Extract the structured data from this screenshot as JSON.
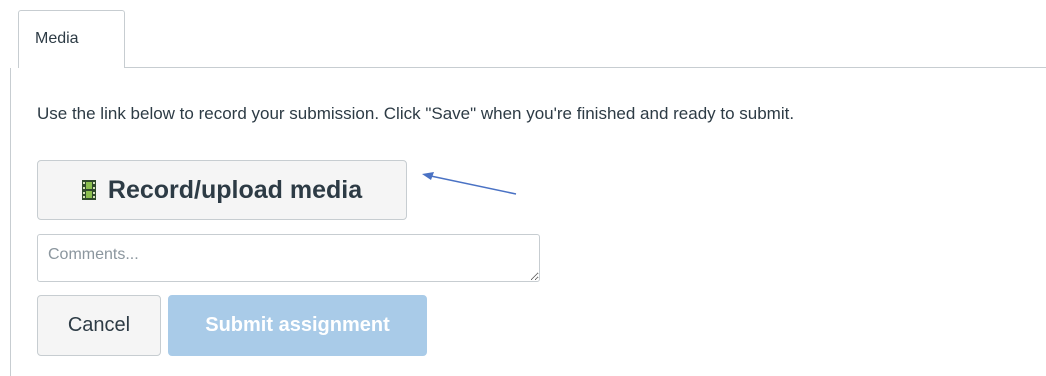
{
  "tabs": [
    {
      "label": "Media",
      "active": true
    }
  ],
  "instructions": "Use the link below to record your submission. Click \"Save\" when you're finished and ready to submit.",
  "record_button": {
    "label": "Record/upload media",
    "icon": "film-icon"
  },
  "annotation": {
    "icon": "arrow-icon",
    "color": "#4a72c4"
  },
  "comments": {
    "placeholder": "Comments...",
    "value": ""
  },
  "actions": {
    "cancel_label": "Cancel",
    "submit_label": "Submit assignment",
    "submit_enabled": false
  },
  "colors": {
    "border": "#c7cdd1",
    "text": "#2d3b45",
    "button_bg": "#f5f5f5",
    "submit_disabled_bg": "#a9cbe8"
  }
}
